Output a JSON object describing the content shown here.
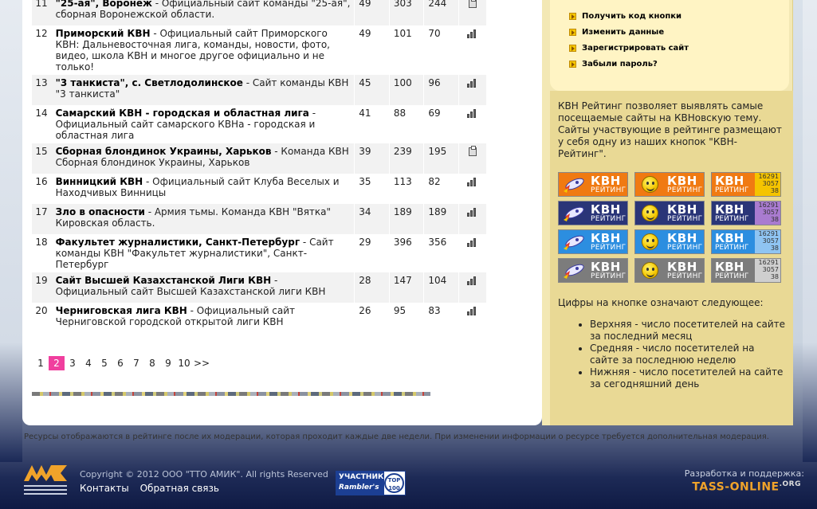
{
  "rows": [
    {
      "num": "11",
      "name": "\"25-ая\", Воронеж",
      "desc": " - Официальный сайт команды \"25-ая\", сборная Воронежской области.",
      "v1": "49",
      "v2": "303",
      "v3": "244",
      "icon": "print-icon"
    },
    {
      "num": "12",
      "name": "Приморский КВН",
      "desc": " - Официальный сайт Приморского КВН: Дальневосточная лига, команды, новости, фото, видео, школа КВН и многое другое официально и не только!",
      "v1": "49",
      "v2": "101",
      "v3": "70",
      "icon": "bars-icon"
    },
    {
      "num": "13",
      "name": "\"3 танкиста\", с. Светлодолинское",
      "desc": " - Сайт команды КВН \"3 танкиста\"",
      "v1": "45",
      "v2": "100",
      "v3": "96",
      "icon": "bars-icon"
    },
    {
      "num": "14",
      "name": "Самарский КВН - городская и областная лига",
      "desc": " - Официальный сайт самарского КВНа - городская и областная лига",
      "v1": "41",
      "v2": "88",
      "v3": "69",
      "icon": "bars-icon"
    },
    {
      "num": "15",
      "name": "Сборная блондинок Украины, Харьков",
      "desc": " - Команда КВН Сборная блондинок Украины, Харьков",
      "v1": "39",
      "v2": "239",
      "v3": "195",
      "icon": "print-icon"
    },
    {
      "num": "16",
      "name": "Винницкий КВН",
      "desc": " - Официальный сайт Клуба Веселых и Находчивых Винницы",
      "v1": "35",
      "v2": "113",
      "v3": "82",
      "icon": "bars-icon"
    },
    {
      "num": "17",
      "name": "Зло в опасности",
      "desc": " - Армия тьмы. Команда КВН \"Вятка\" Кировская область.",
      "v1": "34",
      "v2": "189",
      "v3": "189",
      "icon": "bars-icon"
    },
    {
      "num": "18",
      "name": "Факультет журналистики, Санкт-Петербург",
      "desc": " - Сайт команды КВН \"Факультет журналистики\", Санкт-Петербург",
      "v1": "29",
      "v2": "396",
      "v3": "356",
      "icon": "bars-icon"
    },
    {
      "num": "19",
      "name": "Сайт Высшей Казахстанской Лиги КВН",
      "desc": " - Официальный сайт Высшей Казахстанской лиги КВН",
      "v1": "28",
      "v2": "147",
      "v3": "104",
      "icon": "bars-icon"
    },
    {
      "num": "20",
      "name": "Черниговская лига КВН",
      "desc": " - Официальный сайт Черниговской городской открытой лиги КВН",
      "v1": "26",
      "v2": "95",
      "v3": "83",
      "icon": "bars-icon"
    }
  ],
  "pager": {
    "pages": [
      "1",
      "2",
      "3",
      "4",
      "5",
      "6",
      "7",
      "8",
      "9",
      "10"
    ],
    "active": "2",
    "next": ">>"
  },
  "sidebar": {
    "links": [
      "Получить код кнопки",
      "Изменить данные",
      "Зарегистрировать сайт",
      "Забыли пароль?"
    ],
    "about": "КВН Рейтинг позволяет выявлять самые посещаемые сайты на КВНовскую тему. Сайты участвующие в рейтинге размещают у себя одну из наших кнопок \"КВН-Рейтинг\".",
    "buttons": {
      "big": "КВН",
      "small": "РЕЙТИНГ",
      "counter": [
        "16291",
        "3057",
        "38"
      ],
      "rows": [
        {
          "bg": "#f07a12",
          "counter_bg": "#f5c400"
        },
        {
          "bg": "#2a3578",
          "counter_bg": "#a97bd0"
        },
        {
          "bg": "#2c8ee0",
          "counter_bg": "#8fc4f2"
        },
        {
          "bg": "#7c7c7c",
          "counter_bg": "#cfcfcf"
        }
      ]
    },
    "legend_title": "Цифры на кнопке означают следующее:",
    "legend": [
      "Верхняя - число посетителей на сайте за последний месяц",
      "Средняя - число посетителей на сайте за последнюю неделю",
      "Нижняя - число посетителей на сайте за сегодняшний день"
    ]
  },
  "moderation_note": "Ресурсы отображаются в рейтинге после их модерации, которая проходит каждые две недели. При изменении информации о ресурсе требуется дополнительная модерация.",
  "footer": {
    "copyright": "Copyright © 2012 ООО \"ТТО АМИК\". All rights Reserved",
    "links": [
      "Контакты",
      "Обратная связь"
    ],
    "rambler": {
      "line1": "УЧАСТНИК",
      "line2": "Rambler's",
      "circle": "TOP 100"
    },
    "dev_label": "Разработка и поддержка:",
    "dev_site": "TASS-ONLINE",
    "dev_tld": ".ORG"
  }
}
